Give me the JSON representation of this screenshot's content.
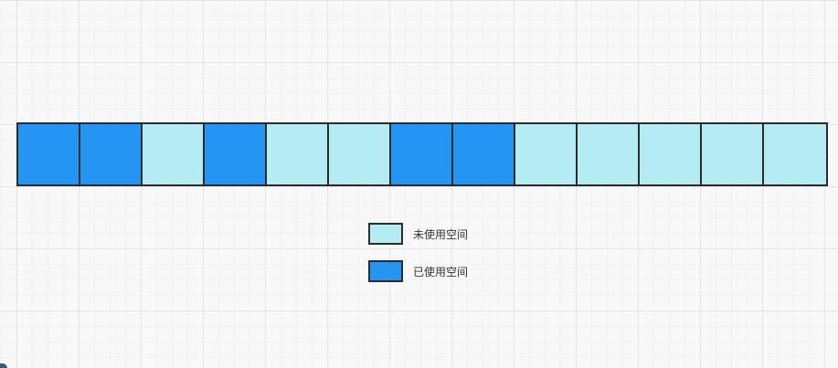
{
  "colors": {
    "unused": "#b5ebf2",
    "used": "#2495f3",
    "border": "#2b2b2b"
  },
  "blocks": [
    "used",
    "used",
    "unused",
    "used",
    "unused",
    "unused",
    "used",
    "used",
    "unused",
    "unused",
    "unused",
    "unused",
    "unused"
  ],
  "legend": {
    "unused_label": "未使用空间",
    "used_label": "已使用空间"
  }
}
